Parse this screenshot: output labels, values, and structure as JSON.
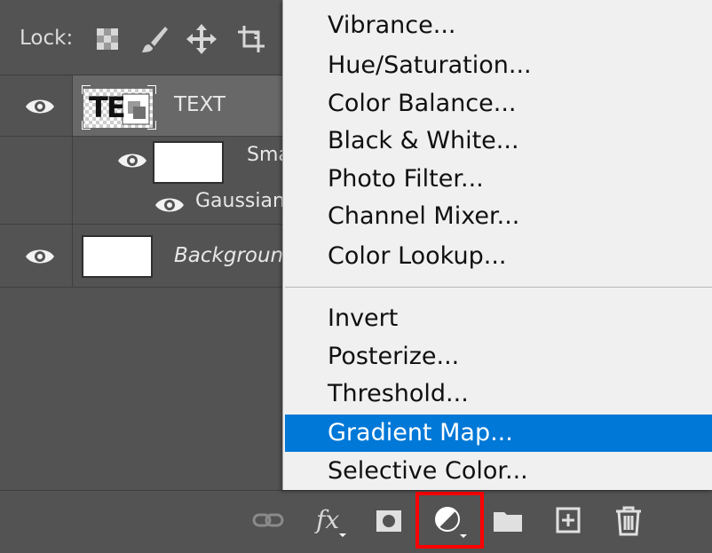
{
  "lock_bar": {
    "label": "Lock:",
    "icons": [
      "transparency-lock-icon",
      "brush-icon",
      "move-icon",
      "artboard-icon"
    ]
  },
  "layers": [
    {
      "name": "TEXT",
      "thumb_text": "TE",
      "selected": true,
      "visible": true
    },
    {
      "name": "Sma",
      "type": "smart-object",
      "visible": true
    },
    {
      "name": "Gaussian",
      "type": "smart-filter",
      "visible": true
    },
    {
      "name": "Background",
      "visible": true,
      "italic": true
    }
  ],
  "menu": {
    "items": [
      {
        "label": "Vibrance..."
      },
      {
        "label": "Hue/Saturation..."
      },
      {
        "label": "Color Balance..."
      },
      {
        "label": "Black & White..."
      },
      {
        "label": "Photo Filter..."
      },
      {
        "label": "Channel Mixer..."
      },
      {
        "label": "Color Lookup..."
      },
      {
        "label": "Invert"
      },
      {
        "label": "Posterize..."
      },
      {
        "label": "Threshold..."
      },
      {
        "label": "Gradient Map...",
        "highlighted": true
      },
      {
        "label": "Selective Color..."
      }
    ]
  },
  "footer": {
    "icons": [
      "link-icon",
      "fx-icon",
      "mask-icon",
      "adjustment-layer-icon",
      "folder-icon",
      "new-layer-icon",
      "trash-icon"
    ],
    "fx_label": "fx"
  },
  "colors": {
    "panel_bg": "#535353",
    "menu_bg": "#f0f0f0",
    "highlight": "#0078d7",
    "outline_red": "#ff0000"
  }
}
